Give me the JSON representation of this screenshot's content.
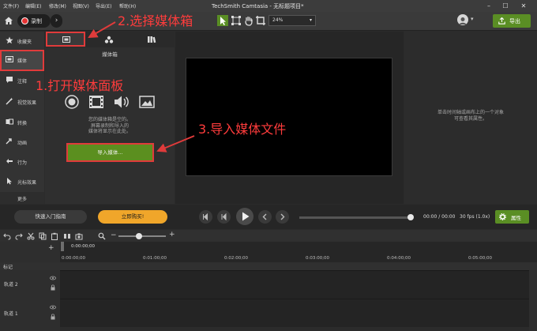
{
  "window": {
    "menus": [
      "文件(F)",
      "编辑(E)",
      "修改(M)",
      "视图(V)",
      "导出(E)",
      "帮助(H)"
    ],
    "title": "TechSmith Camtasia - 无标题项目*",
    "minimize": "–",
    "maximize": "☐",
    "close": "✕"
  },
  "toolbar": {
    "record_label": "录制",
    "zoom_value": "24%",
    "export_label": "导出"
  },
  "sidebar": {
    "items": [
      {
        "label": "收藏夹"
      },
      {
        "label": "媒体"
      },
      {
        "label": "注释"
      },
      {
        "label": "视觉效果"
      },
      {
        "label": "转换"
      },
      {
        "label": "动画"
      },
      {
        "label": "行为"
      },
      {
        "label": "光标效果"
      }
    ],
    "more_label": "更多",
    "add_label": "+"
  },
  "media_bin": {
    "title": "媒体箱",
    "empty_line1": "您的媒体箱是空的。",
    "empty_line2": "屏幕录制和导入的",
    "empty_line3": "媒体将显示在此处。",
    "import_button": "导入媒体..."
  },
  "properties": {
    "hint_line1": "单击时间轴或画布上的一个对象",
    "hint_line2": "可查看其属性。"
  },
  "playback": {
    "quick_start": "快速入门指南",
    "buy_now": "立即购买!",
    "time": "00:00 / 00:00",
    "fps": "30 fps (1.0x)",
    "properties_button": "属性"
  },
  "timeline": {
    "playhead_time": "0:00:00;00",
    "ruler_ticks": [
      "0:00:00;00",
      "0:01:00;00",
      "0:02:00;00",
      "0:03:00;00",
      "0:04:00;00",
      "0:05:00;00"
    ],
    "marker_label": "标记",
    "tracks": [
      {
        "name": "轨道 2"
      },
      {
        "name": "轨道 1"
      }
    ]
  },
  "annotations": {
    "step1": "1.打开媒体面板",
    "step2": "2.选择媒体箱",
    "step3": "3.导入媒体文件"
  },
  "colors": {
    "accent_green": "#5a8e24",
    "annotation_red": "#e03b3b",
    "buy_orange": "#f0a62a"
  }
}
